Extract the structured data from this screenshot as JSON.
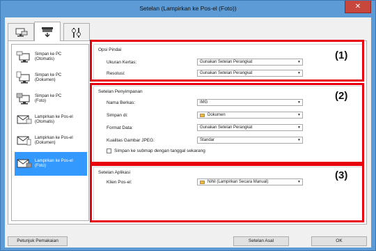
{
  "window": {
    "title": "Setelan (Lampirkan ke Pos-el (Foto))"
  },
  "tabs": [
    {
      "icon": "scan-from-computer-icon"
    },
    {
      "icon": "scan-from-operation-panel-icon"
    },
    {
      "icon": "general-settings-icon"
    }
  ],
  "sidebar": {
    "items": [
      {
        "label_line1": "Simpan ke PC",
        "label_line2": "(Otomatis)",
        "icon": "save-to-pc-icon"
      },
      {
        "label_line1": "Simpan ke PC",
        "label_line2": "(Dokumen)",
        "icon": "save-to-pc-icon"
      },
      {
        "label_line1": "Simpan ke PC",
        "label_line2": "(Foto)",
        "icon": "save-to-pc-icon"
      },
      {
        "label_line1": "Lampirkan ke Pos-el",
        "label_line2": "(Otomatis)",
        "icon": "email-attach-icon"
      },
      {
        "label_line1": "Lampirkan ke Pos-el",
        "label_line2": "(Dokumen)",
        "icon": "email-attach-icon"
      },
      {
        "label_line1": "Lampirkan ke Pos-el",
        "label_line2": "(Foto)",
        "icon": "email-attach-icon"
      }
    ]
  },
  "scan_options": {
    "title": "Opsi Pindai",
    "paper_size_label": "Ukuran Kertas:",
    "paper_size_value": "Gunakan Setelan Perangkat",
    "resolution_label": "Resolusi:",
    "resolution_value": "Gunakan Setelan Perangkat"
  },
  "save_settings": {
    "title": "Setelan Penyimpanan",
    "filename_label": "Nama Berkas:",
    "filename_value": "IMG",
    "save_in_label": "Simpan di:",
    "save_in_value": "Dokumen",
    "data_format_label": "Format Data:",
    "data_format_value": "Gunakan Setelan Perangkat",
    "jpeg_quality_label": "Kualitas Gambar JPEG:",
    "jpeg_quality_value": "Standar",
    "subfolder_label": "Simpan ke submap dengan tanggal sekarang",
    "subfolder_checked": false
  },
  "app_settings": {
    "title": "Setelan Aplikasi",
    "email_client_label": "Klien Pos-el:",
    "email_client_value": "Nihil (Lampirkan Secara Manual)"
  },
  "callouts": {
    "one": "(1)",
    "two": "(2)",
    "three": "(3)"
  },
  "buttons": {
    "instructions": "Petunjuk Pemakaian",
    "defaults": "Setelan Asal",
    "ok": "OK"
  },
  "colors": {
    "highlight": "#e8000d",
    "selection": "#3399ff",
    "window_frame": "#5d9bd6"
  }
}
